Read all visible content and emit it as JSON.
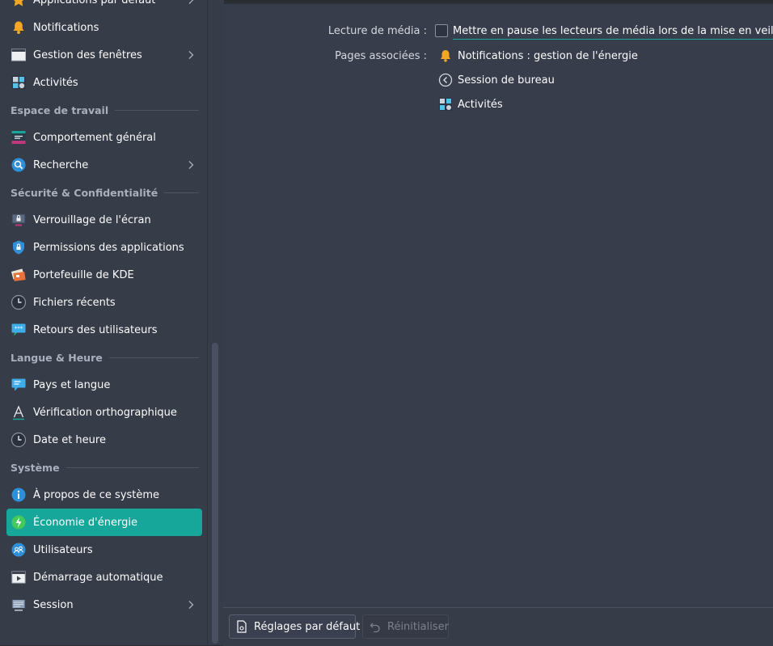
{
  "sidebar": {
    "items_top": [
      {
        "label": "Applications par défaut",
        "icon": "star-icon",
        "has_children": true
      },
      {
        "label": "Notifications",
        "icon": "bell-icon",
        "has_children": false
      },
      {
        "label": "Gestion des fenêtres",
        "icon": "window-icon",
        "has_children": true
      },
      {
        "label": "Activités",
        "icon": "activities-icon",
        "has_children": false
      }
    ],
    "sections": [
      {
        "title": "Espace de travail",
        "items": [
          {
            "label": "Comportement général",
            "icon": "general-behavior-icon",
            "has_children": false
          },
          {
            "label": "Recherche",
            "icon": "search-icon",
            "has_children": true
          }
        ]
      },
      {
        "title": "Sécurité & Confidentialité",
        "items": [
          {
            "label": "Verrouillage de l'écran",
            "icon": "screen-lock-icon",
            "has_children": false
          },
          {
            "label": "Permissions des applications",
            "icon": "shield-icon",
            "has_children": false
          },
          {
            "label": "Portefeuille de KDE",
            "icon": "wallet-icon",
            "has_children": false
          },
          {
            "label": "Fichiers récents",
            "icon": "clock-icon",
            "has_children": false
          },
          {
            "label": "Retours des utilisateurs",
            "icon": "feedback-icon",
            "has_children": false
          }
        ]
      },
      {
        "title": "Langue & Heure",
        "items": [
          {
            "label": "Pays et langue",
            "icon": "speech-bubble-icon",
            "has_children": false
          },
          {
            "label": "Vérification orthographique",
            "icon": "spellcheck-icon",
            "has_children": false
          },
          {
            "label": "Date et heure",
            "icon": "clock-icon",
            "has_children": false
          }
        ]
      },
      {
        "title": "Système",
        "items": [
          {
            "label": "À propos de ce système",
            "icon": "info-icon",
            "has_children": false
          },
          {
            "label": "Économie d'énergie",
            "icon": "power-icon",
            "has_children": false,
            "active": true
          },
          {
            "label": "Utilisateurs",
            "icon": "users-icon",
            "has_children": false
          },
          {
            "label": "Démarrage automatique",
            "icon": "autostart-icon",
            "has_children": false
          },
          {
            "label": "Session",
            "icon": "session-icon",
            "has_children": true
          }
        ]
      }
    ]
  },
  "content": {
    "media_label": "Lecture de média :",
    "media_checkbox_label": "Mettre en pause les lecteurs de média lors de la mise en veille",
    "media_checkbox_checked": false,
    "related_label": "Pages associées :",
    "related_links": [
      {
        "label": "Notifications : gestion de l'énergie",
        "icon": "bell-icon"
      },
      {
        "label": "Session de bureau",
        "icon": "back-circle-icon"
      },
      {
        "label": "Activités",
        "icon": "activities-icon"
      }
    ]
  },
  "footer": {
    "defaults_label": "Réglages par défaut",
    "reset_label": "Réinitialiser"
  },
  "colors": {
    "accent": "#16a79a",
    "sidebar_bg": "#373c49",
    "content_bg": "#383d4b"
  }
}
